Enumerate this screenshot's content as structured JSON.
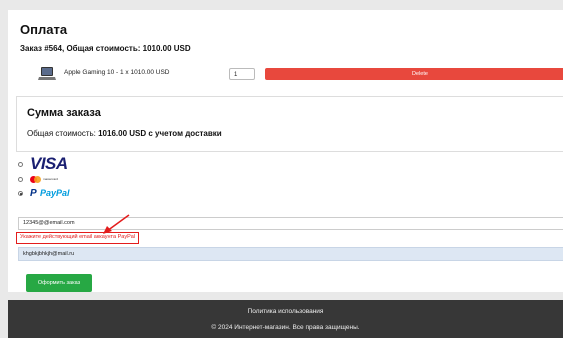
{
  "page": {
    "title": "Оплата"
  },
  "order": {
    "heading": "Заказ #564, Общая стоимость: 1010.00 USD"
  },
  "cart": {
    "item_text": "Apple Gaming 10 - 1 x 1010.00 USD",
    "quantity": "1",
    "delete_label": "Delete"
  },
  "summary": {
    "title": "Сумма заказа",
    "total_label": "Общая стоимость: ",
    "total_value": "1016.00 USD с учетом доставки"
  },
  "payment": {
    "options": [
      {
        "name": "VISA",
        "selected": false
      },
      {
        "name": "mastercard",
        "selected": false
      },
      {
        "name": "PayPal",
        "selected": true
      }
    ],
    "visa_text": "VISA",
    "mastercard_text": "mastercard",
    "paypal_text": "PayPal"
  },
  "form": {
    "email_value": "12345@@email.com",
    "error_message": "Укажите действующий email аккаунта PayPal",
    "autofill_value": "khgbkjbhkjh@mail.ru",
    "submit_label": "Оформить заказ"
  },
  "footer": {
    "policy_link": "Политика использования",
    "copyright": "© 2024 Интернет-магазин. Все права защищены."
  },
  "colors": {
    "delete": "#e8483d",
    "submit": "#27a844",
    "error": "#e31c1c",
    "footer_bg": "#373737",
    "autofill_bg": "#dde7f3"
  }
}
